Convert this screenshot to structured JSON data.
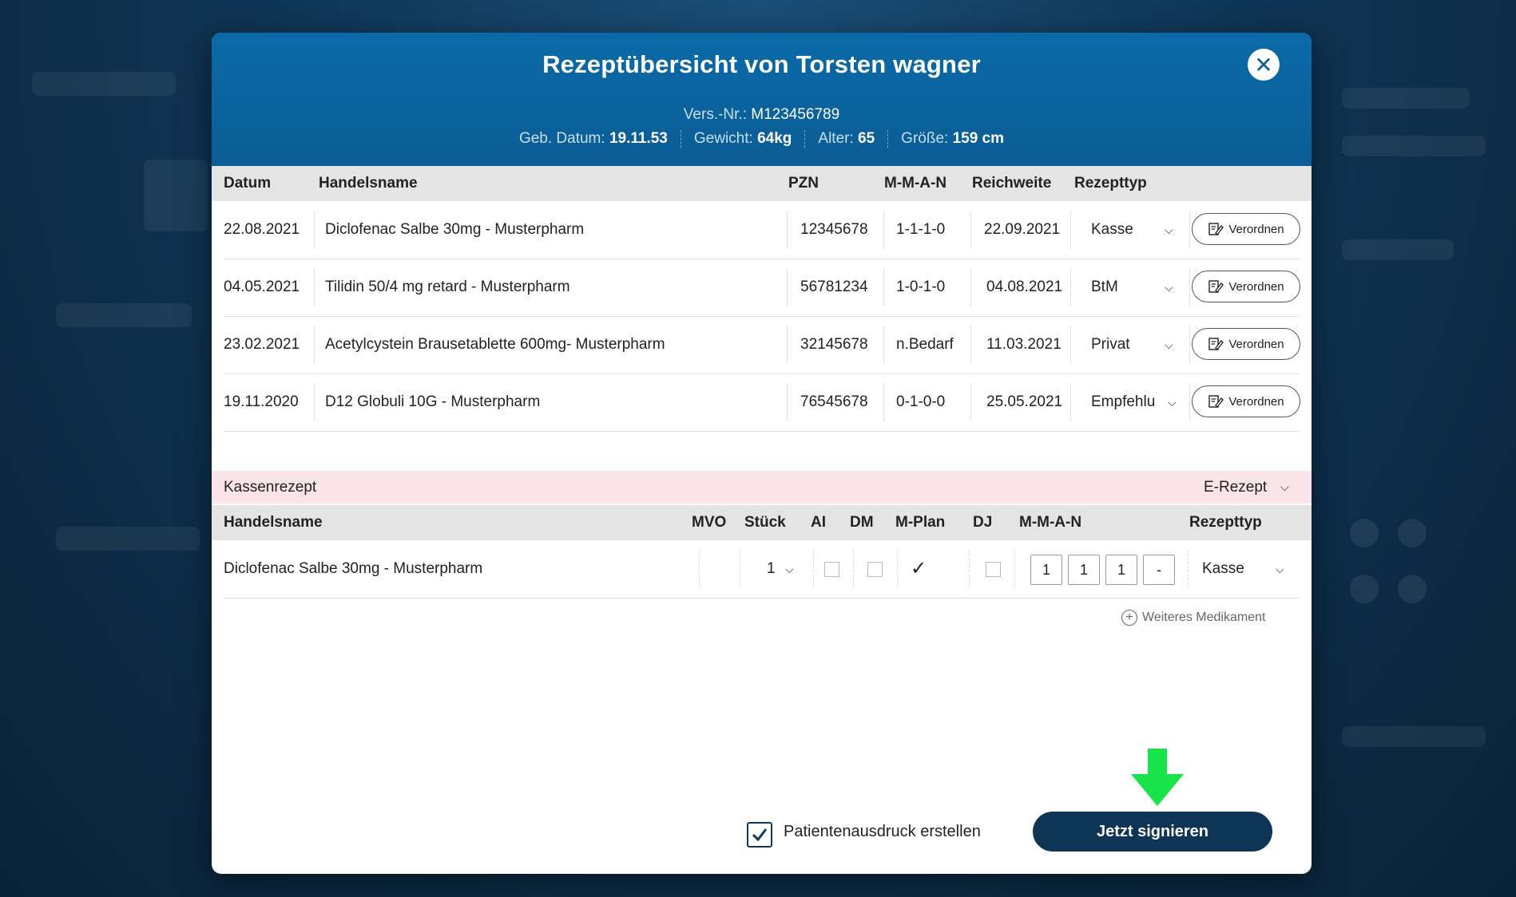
{
  "modal": {
    "title": "Rezeptübersicht von Torsten wagner",
    "vers_label": "Vers.-Nr.:",
    "vers_value": "M123456789",
    "meta": [
      {
        "label": "Geb. Datum:",
        "value": "19.11.53"
      },
      {
        "label": "Gewicht:",
        "value": "64kg"
      },
      {
        "label": "Alter:",
        "value": "65"
      },
      {
        "label": "Größe:",
        "value": "159 cm"
      }
    ]
  },
  "history_table": {
    "headers": {
      "datum": "Datum",
      "handelsname": "Handelsname",
      "pzn": "PZN",
      "mman": "M-M-A-N",
      "reichweite": "Reichweite",
      "rezepttyp": "Rezepttyp"
    },
    "button_label": "Verordnen",
    "rows": [
      {
        "datum": "22.08.2021",
        "name": "Diclofenac Salbe 30mg - Musterpharm",
        "pzn": "12345678",
        "mman": "1-1-1-0",
        "reichweite": "22.09.2021",
        "typ": "Kasse"
      },
      {
        "datum": "04.05.2021",
        "name": "Tilidin 50/4 mg retard - Musterpharm",
        "pzn": "56781234",
        "mman": "1-0-1-0",
        "reichweite": "04.08.2021",
        "typ": "BtM"
      },
      {
        "datum": "23.02.2021",
        "name": "Acetylcystein Brausetablette 600mg- Musterpharm",
        "pzn": "32145678",
        "mman": "n.Bedarf",
        "reichweite": "11.03.2021",
        "typ": "Privat"
      },
      {
        "datum": "19.11.2020",
        "name": "D12 Globuli 10G - Musterpharm",
        "pzn": "76545678",
        "mman": "0-1-0-0",
        "reichweite": "25.05.2021",
        "typ": "Empfehlu"
      }
    ]
  },
  "kassenrezept": {
    "label": "Kassenrezept",
    "type_select": "E-Rezept",
    "headers": {
      "handelsname": "Handelsname",
      "mvo": "MVO",
      "stueck": "Stück",
      "ai": "AI",
      "dm": "DM",
      "mplan": "M-Plan",
      "dj": "DJ",
      "mman": "M-M-A-N",
      "rezepttyp": "Rezepttyp"
    },
    "row": {
      "name": "Diclofenac Salbe 30mg - Musterpharm",
      "stueck": "1",
      "mman": [
        "1",
        "1",
        "1",
        "-"
      ],
      "typ": "Kasse",
      "ai_checked": false,
      "dm_checked": false,
      "mplan_checked": true,
      "dj_checked": false
    },
    "add_label": "Weiteres Medikament"
  },
  "footer": {
    "print_label": "Patientenausdruck erstellen",
    "print_checked": true,
    "sign_label": "Jetzt signieren"
  },
  "colors": {
    "header_blue": "#0b5d95",
    "sign_button": "#0e3555",
    "kassen_bar": "#fbe4e7",
    "arrow_green": "#19e34b"
  }
}
